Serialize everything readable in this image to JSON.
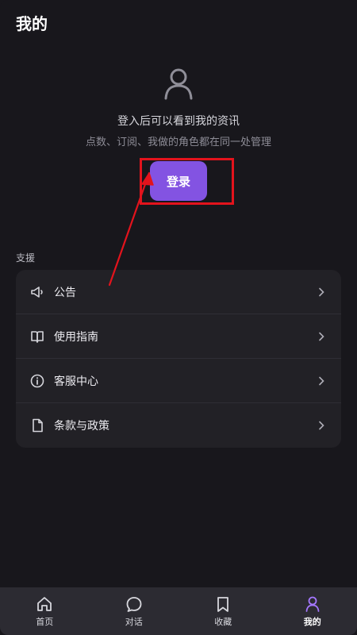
{
  "header": {
    "title": "我的"
  },
  "login": {
    "title": "登入后可以看到我的资讯",
    "subtitle": "点数、订阅、我做的角色都在同一处管理",
    "button_label": "登录",
    "icon": "user-icon"
  },
  "support": {
    "section_label": "支援",
    "items": [
      {
        "label": "公告",
        "icon": "megaphone-icon"
      },
      {
        "label": "使用指南",
        "icon": "book-icon"
      },
      {
        "label": "客服中心",
        "icon": "info-icon"
      },
      {
        "label": "条款与政策",
        "icon": "document-icon"
      }
    ]
  },
  "bottom_nav": {
    "tabs": [
      {
        "label": "首页",
        "icon": "home-icon"
      },
      {
        "label": "对话",
        "icon": "chat-icon"
      },
      {
        "label": "收藏",
        "icon": "bookmark-icon"
      },
      {
        "label": "我的",
        "icon": "user-icon",
        "active": true
      }
    ]
  },
  "colors": {
    "background": "#18171c",
    "card": "#222126",
    "accent": "#8353e2",
    "active_nav": "#a477ff",
    "annotation": "#e3131c"
  }
}
